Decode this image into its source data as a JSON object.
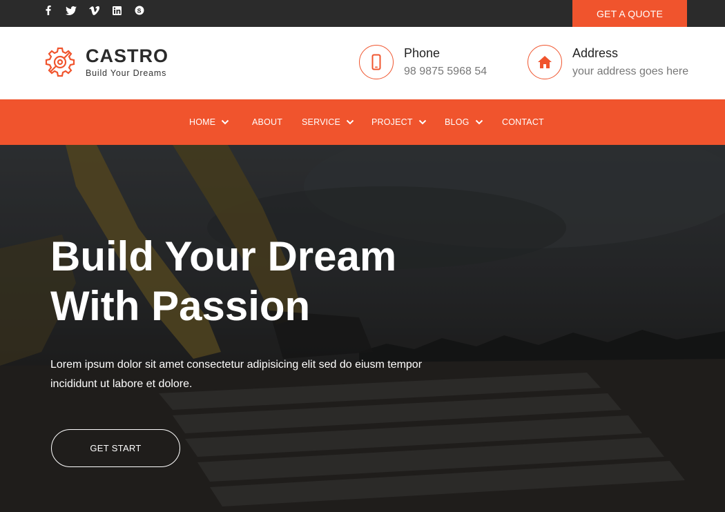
{
  "topbar": {
    "socials": [
      {
        "icon": "facebook-icon"
      },
      {
        "icon": "twitter-icon"
      },
      {
        "icon": "vimeo-icon"
      },
      {
        "icon": "linkedin-icon"
      },
      {
        "icon": "skype-icon"
      }
    ],
    "quote_label": "GET A QUOTE"
  },
  "header": {
    "brand": "CASTRO",
    "tagline": "Build Your Dreams",
    "phone": {
      "title": "Phone",
      "value": "98 9875 5968 54"
    },
    "address": {
      "title": "Address",
      "value": "your address goes here"
    }
  },
  "nav": {
    "items": [
      {
        "label": "HOME",
        "dropdown": true
      },
      {
        "label": "ABOUT",
        "dropdown": false
      },
      {
        "label": "SERVICE",
        "dropdown": true
      },
      {
        "label": "PROJECT",
        "dropdown": true
      },
      {
        "label": "BLOG",
        "dropdown": true
      },
      {
        "label": "CONTACT",
        "dropdown": false
      }
    ]
  },
  "hero": {
    "title_line1": "Build Your Dream",
    "title_line2": "With Passion",
    "text": "Lorem ipsum dolor sit amet consectetur adipisicing elit sed do eiusm tempor incididunt ut labore et dolore.",
    "button_label": "GET START"
  },
  "colors": {
    "accent": "#f0542d",
    "topbar": "#2b2b2b",
    "white": "#ffffff"
  }
}
